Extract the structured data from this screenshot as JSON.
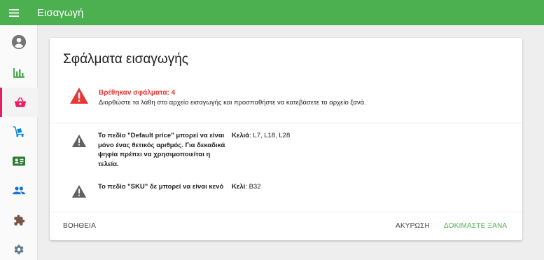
{
  "app": {
    "title": "Εισαγωγή",
    "accent_color": "#4caf50",
    "active_color": "#e91e63",
    "error_color": "#e53935"
  },
  "sidebar": {
    "items": [
      {
        "icon": "account-circle-icon",
        "active": false
      },
      {
        "icon": "bar-chart-icon",
        "active": false
      },
      {
        "icon": "shopping-basket-icon",
        "active": true
      },
      {
        "icon": "cart-dolly-icon",
        "active": false
      },
      {
        "icon": "contact-card-icon",
        "active": false
      },
      {
        "icon": "people-icon",
        "active": false
      },
      {
        "icon": "puzzle-icon",
        "active": false
      },
      {
        "icon": "settings-gear-icon",
        "active": false
      }
    ]
  },
  "dialog": {
    "title": "Σφάλματα εισαγωγής",
    "summary": {
      "heading": "Βρέθηκαν σφάλματα: 4",
      "text": "Διορθώστε τα λάθη στο αρχείο εισαγωγής και προσπαθήστε να κατεβάσετε το αρχείο ξανά."
    },
    "errors": [
      {
        "message": "Το πεδίο \"Default price\" μπορεί να είναι μόνο ένας θετικός αριθμός. Για δεκαδικά ψηφία πρέπει να χρησιμοποιείται η τελεία.",
        "cells_label": "Κελιά",
        "cells_value": ": L7, L18,  L28"
      },
      {
        "message": "Το πεδίο \"SKU\" δε μπορεί να είναι κενό",
        "cells_label": "Κελί",
        "cells_value": ": B32"
      }
    ],
    "actions": {
      "help": "ΒΟΗΘΕΙΑ",
      "cancel": "ΑΚΥΡΩΣΗ",
      "retry": "ΔΟΚΙΜΑΣΤΕ ΞΑΝΑ"
    }
  }
}
